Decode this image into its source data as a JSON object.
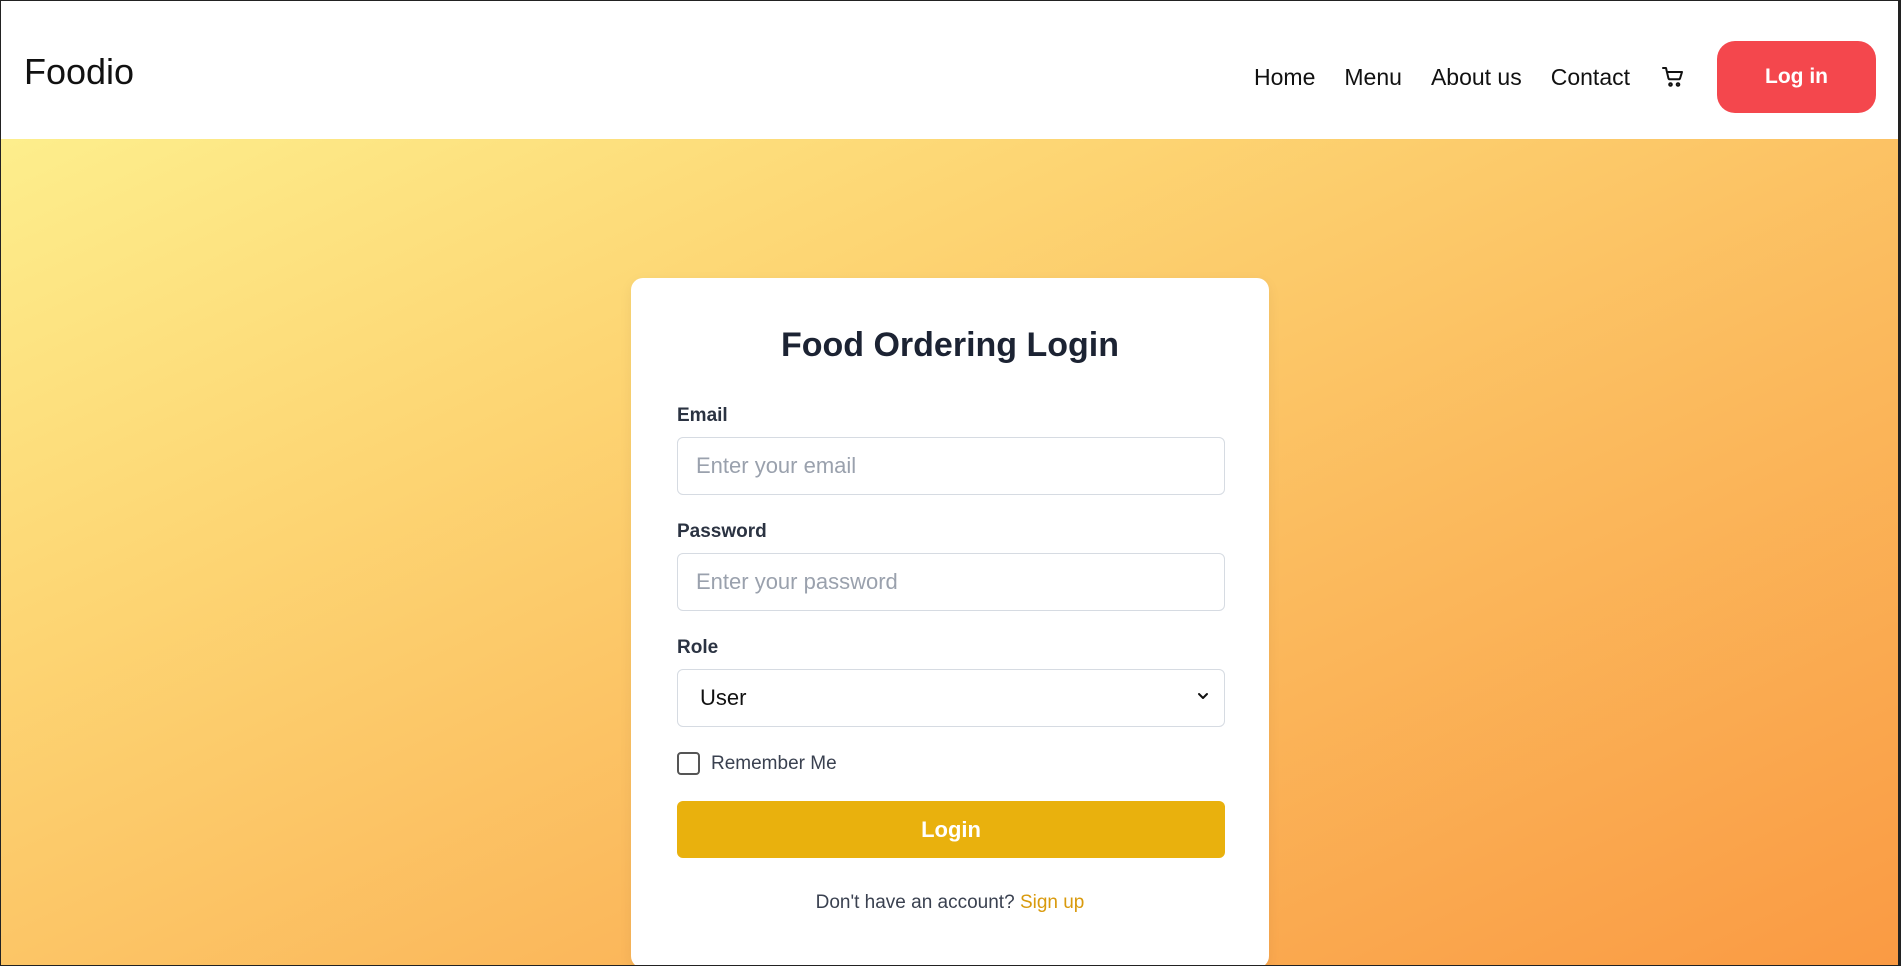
{
  "header": {
    "brand": "Foodio",
    "nav": [
      "Home",
      "Menu",
      "About us",
      "Contact"
    ],
    "cart_icon": "cart-icon",
    "login_label": "Log in"
  },
  "login_card": {
    "title": "Food Ordering Login",
    "email": {
      "label": "Email",
      "placeholder": "Enter your email",
      "value": ""
    },
    "password": {
      "label": "Password",
      "placeholder": "Enter your password",
      "value": ""
    },
    "role": {
      "label": "Role",
      "selected": "User",
      "chevron_icon": "chevron-down-icon"
    },
    "remember_label": "Remember Me",
    "remember_checked": false,
    "submit_label": "Login",
    "signup_prompt": "Don't have an account?",
    "signup_link": "Sign up"
  },
  "colors": {
    "accent_red": "#f4474d",
    "login_button": "#e9b10d",
    "link": "#d99a0d",
    "gradient_start": "#fdee8c",
    "gradient_end": "#fa9a43"
  }
}
